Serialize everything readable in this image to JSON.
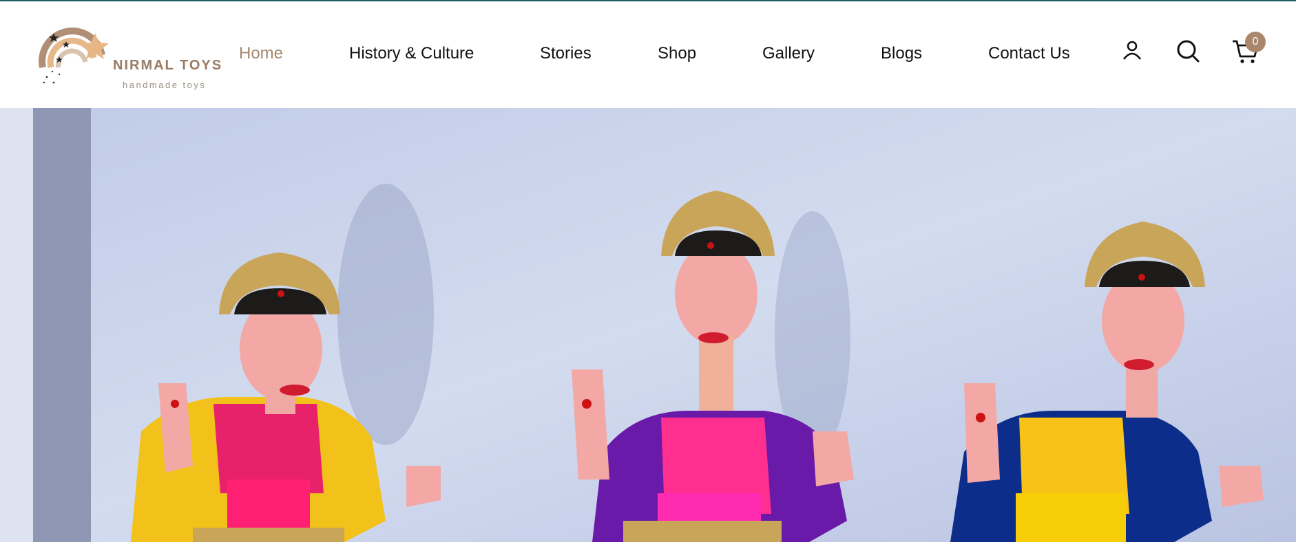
{
  "brand": {
    "name": "NIRMAL TOYS",
    "tagline": "handmade toys"
  },
  "nav": {
    "items": [
      {
        "label": "Home",
        "active": true
      },
      {
        "label": "History & Culture",
        "active": false
      },
      {
        "label": "Stories",
        "active": false
      },
      {
        "label": "Shop",
        "active": false
      },
      {
        "label": "Gallery",
        "active": false
      },
      {
        "label": "Blogs",
        "active": false
      },
      {
        "label": "Contact Us",
        "active": false
      }
    ]
  },
  "actions": {
    "account_icon": "user-icon",
    "search_icon": "search-icon",
    "cart_icon": "cart-icon",
    "cart_count": "0"
  },
  "colors": {
    "accent": "#a5876c",
    "top_rule": "#1f5f63",
    "badge": "#a9876d"
  }
}
